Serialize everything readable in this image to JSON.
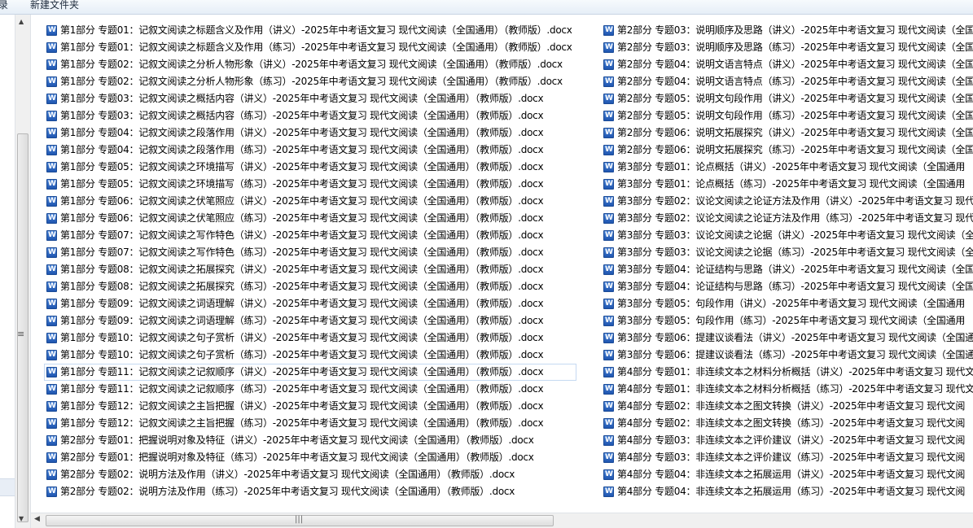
{
  "toolbar": {
    "left_item": "录",
    "new_folder_label": "新建文件夹"
  },
  "files": {
    "columns": [
      [
        "第1部分 专题01：记叙文阅读之标题含义及作用（讲义）-2025年中考语文复习 现代文阅读（全国通用）（教师版）.docx",
        "第1部分 专题01：记叙文阅读之标题含义及作用（练习）-2025年中考语文复习 现代文阅读（全国通用）（教师版）.docx",
        "第1部分 专题02：记叙文阅读之分析人物形象（讲义）-2025年中考语文复习 现代文阅读（全国通用）（教师版）.docx",
        "第1部分 专题02：记叙文阅读之分析人物形象（练习）-2025年中考语文复习 现代文阅读（全国通用）（教师版）.docx",
        "第1部分 专题03：记叙文阅读之概括内容（讲义）-2025年中考语文复习 现代文阅读（全国通用）（教师版）.docx",
        "第1部分 专题03：记叙文阅读之概括内容（练习）-2025年中考语文复习 现代文阅读（全国通用）（教师版）.docx",
        "第1部分 专题04：记叙文阅读之段落作用（讲义）-2025年中考语文复习 现代文阅读（全国通用）（教师版）.docx",
        "第1部分 专题04：记叙文阅读之段落作用（练习）-2025年中考语文复习 现代文阅读（全国通用）（教师版）.docx",
        "第1部分 专题05：记叙文阅读之环境描写（讲义）-2025年中考语文复习 现代文阅读（全国通用）（教师版）.docx",
        "第1部分 专题05：记叙文阅读之环境描写（练习）-2025年中考语文复习 现代文阅读（全国通用）（教师版）.docx",
        "第1部分 专题06：记叙文阅读之伏笔照应（讲义）-2025年中考语文复习 现代文阅读（全国通用）（教师版）.docx",
        "第1部分 专题06：记叙文阅读之伏笔照应（练习）-2025年中考语文复习 现代文阅读（全国通用）（教师版）.docx",
        "第1部分 专题07：记叙文阅读之写作特色（讲义）-2025年中考语文复习 现代文阅读（全国通用）（教师版）.docx",
        "第1部分 专题07：记叙文阅读之写作特色（练习）-2025年中考语文复习 现代文阅读（全国通用）（教师版）.docx",
        "第1部分 专题08：记叙文阅读之拓展探究（讲义）-2025年中考语文复习 现代文阅读（全国通用）（教师版）.docx",
        "第1部分 专题08：记叙文阅读之拓展探究（练习）-2025年中考语文复习 现代文阅读（全国通用）（教师版）.docx",
        "第1部分 专题09：记叙文阅读之词语理解（讲义）-2025年中考语文复习 现代文阅读（全国通用）（教师版）.docx",
        "第1部分 专题09：记叙文阅读之词语理解（练习）-2025年中考语文复习 现代文阅读（全国通用）（教师版）.docx",
        "第1部分 专题10：记叙文阅读之句子赏析（讲义）-2025年中考语文复习 现代文阅读（全国通用）（教师版）.docx",
        "第1部分 专题10：记叙文阅读之句子赏析（练习）-2025年中考语文复习 现代文阅读（全国通用）（教师版）.docx",
        "第1部分 专题11：记叙文阅读之记叙顺序（讲义）-2025年中考语文复习 现代文阅读（全国通用）（教师版）.docx",
        "第1部分 专题11：记叙文阅读之记叙顺序（练习）-2025年中考语文复习 现代文阅读（全国通用）（教师版）.docx",
        "第1部分 专题12：记叙文阅读之主旨把握（讲义）-2025年中考语文复习 现代文阅读（全国通用）（教师版）.docx",
        "第1部分 专题12：记叙文阅读之主旨把握（练习）-2025年中考语文复习 现代文阅读（全国通用）（教师版）.docx",
        "第2部分 专题01：把握说明对象及特征（讲义）-2025年中考语文复习 现代文阅读（全国通用）（教师版）.docx",
        "第2部分 专题01：把握说明对象及特征（练习）-2025年中考语文复习 现代文阅读（全国通用）（教师版）.docx",
        "第2部分 专题02：说明方法及作用（讲义）-2025年中考语文复习 现代文阅读（全国通用）（教师版）.docx",
        "第2部分 专题02：说明方法及作用（练习）-2025年中考语文复习 现代文阅读（全国通用）（教师版）.docx"
      ],
      [
        "第2部分 专题03：说明顺序及思路（讲义）-2025年中考语文复习 现代文阅读（全国",
        "第2部分 专题03：说明顺序及思路（练习）-2025年中考语文复习 现代文阅读（全国",
        "第2部分 专题04：说明文语言特点（讲义）-2025年中考语文复习 现代文阅读（全国",
        "第2部分 专题04：说明文语言特点（练习）-2025年中考语文复习 现代文阅读（全国",
        "第2部分 专题05：说明文句段作用（讲义）-2025年中考语文复习 现代文阅读（全国",
        "第2部分 专题05：说明文句段作用（练习）-2025年中考语文复习 现代文阅读（全国",
        "第2部分 专题06：说明文拓展探究（讲义）-2025年中考语文复习 现代文阅读（全国",
        "第2部分 专题06：说明文拓展探究（练习）-2025年中考语文复习 现代文阅读（全国",
        "第3部分 专题01：论点概括（讲义）-2025年中考语文复习 现代文阅读（全国通用",
        "第3部分 专题01：论点概括（练习）-2025年中考语文复习 现代文阅读（全国通用",
        "第3部分 专题02：议论文阅读之论证方法及作用（讲义）-2025年中考语文复习 现代",
        "第3部分 专题02：议论文阅读之论证方法及作用（练习）-2025年中考语文复习 现代",
        "第3部分 专题03：议论文阅读之论据（讲义）-2025年中考语文复习 现代文阅读（全",
        "第3部分 专题03：议论文阅读之论据（练习）-2025年中考语文复习 现代文阅读（全",
        "第3部分 专题04：论证结构与思路（讲义）-2025年中考语文复习 现代文阅读（全国",
        "第3部分 专题04：论证结构与思路（练习）-2025年中考语文复习 现代文阅读（全国",
        "第3部分 专题05：句段作用（讲义）-2025年中考语文复习 现代文阅读（全国通用",
        "第3部分 专题05：句段作用（练习）-2025年中考语文复习 现代文阅读（全国通用",
        "第3部分 专题06：提建议谈看法（讲义）-2025年中考语文复习 现代文阅读（全国通",
        "第3部分 专题06：提建议谈看法（练习）-2025年中考语文复习 现代文阅读（全国通",
        "第4部分 专题01：非连续文本之材料分析概括（讲义）-2025年中考语文复习 现代文",
        "第4部分 专题01：非连续文本之材料分析概括（练习）-2025年中考语文复习 现代文",
        "第4部分 专题02：非连续文本之图文转换（讲义）-2025年中考语文复习 现代文阅",
        "第4部分 专题02：非连续文本之图文转换（练习）-2025年中考语文复习 现代文阅",
        "第4部分 专题03：非连续文本之评价建议（讲义）-2025年中考语文复习 现代文阅",
        "第4部分 专题03：非连续文本之评价建议（练习）-2025年中考语文复习 现代文阅",
        "第4部分 专题04：非连续文本之拓展运用（讲义）-2025年中考语文复习 现代文阅",
        "第4部分 专题04：非连续文本之拓展运用（练习）-2025年中考语文复习 现代文阅"
      ]
    ],
    "selected": [
      0,
      20
    ],
    "icon": "word-doc-icon"
  },
  "scrollbars": {
    "vertical_arrows": [
      "▲",
      "▼"
    ],
    "splitter_grip": "≡",
    "horizontal_arrow": "◀",
    "horizontal_grip": "|||"
  }
}
